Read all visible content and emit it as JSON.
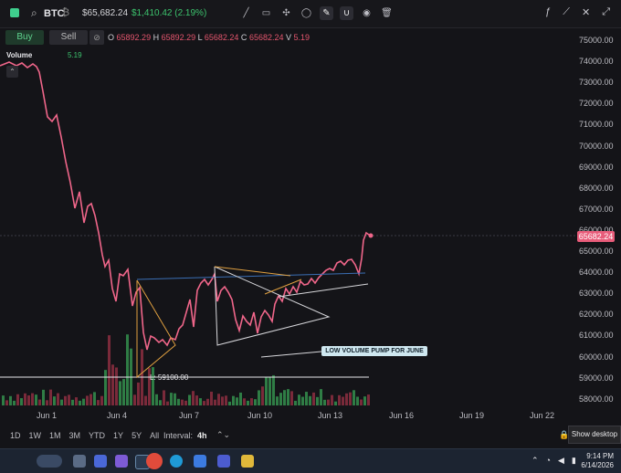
{
  "header": {
    "symbol": "BTC",
    "price": "$65,682.24",
    "change": "$1,410.42 (2.19%)",
    "tools": [
      "pen-icon",
      "rectangle-icon",
      "crosshair-icon",
      "ellipse-icon",
      "brush-icon",
      "magnet-icon",
      "eye-icon",
      "trash-icon"
    ],
    "right_tools": [
      "formula-icon",
      "line-chart-icon",
      "xmark-icon",
      "expand-icon"
    ]
  },
  "trade": {
    "buy_label": "Buy",
    "sell_label": "Sell"
  },
  "ohlc": {
    "o_label": "O",
    "o": "65892.29",
    "h_label": "H",
    "h": "65892.29",
    "l_label": "L",
    "l": "65682.24",
    "c_label": "C",
    "c": "65682.24",
    "v_label": "V",
    "v": "5.19"
  },
  "volume": {
    "label": "Volume",
    "value": "5.19"
  },
  "y_axis": [
    "75000.00",
    "74000.00",
    "73000.00",
    "72000.00",
    "71000.00",
    "70000.00",
    "69000.00",
    "68000.00",
    "67000.00",
    "66000.00",
    "65000.00",
    "64000.00",
    "63000.00",
    "62000.00",
    "61000.00",
    "60000.00",
    "59000.00",
    "58000.00"
  ],
  "current_price_tag": "65682.24",
  "x_axis": [
    "Jun 1",
    "Jun 4",
    "Jun 7",
    "Jun 10",
    "Jun 13",
    "Jun 16",
    "Jun 19",
    "Jun 22"
  ],
  "timeframes": [
    "1D",
    "1W",
    "1M",
    "3M",
    "YTD",
    "1Y",
    "5Y",
    "All"
  ],
  "interval": {
    "label": "Interval:",
    "value": "4h"
  },
  "annotation": "LOW VOLUME PUMP FOR JUNE",
  "low_line_label": "L: 59100.00",
  "tooltip": "Show desktop",
  "clock": {
    "time": "9:14 PM",
    "date": "6/14/2026"
  },
  "colors": {
    "line": "#f0668a",
    "up": "#3fb950",
    "down": "#e5566e",
    "accent": "#3fcf8e"
  },
  "chart_data": {
    "type": "line",
    "x": [
      "May 31",
      "Jun 1",
      "Jun 2",
      "Jun 3",
      "Jun 4",
      "Jun 5",
      "Jun 6",
      "Jun 7",
      "Jun 8",
      "Jun 9",
      "Jun 10",
      "Jun 11",
      "Jun 12",
      "Jun 13",
      "Jun 14"
    ],
    "values": [
      73800,
      73600,
      71000,
      67000,
      63600,
      61200,
      62100,
      62500,
      63300,
      61800,
      62000,
      63000,
      63600,
      64200,
      65682
    ],
    "ylim": [
      57800,
      75400
    ]
  }
}
